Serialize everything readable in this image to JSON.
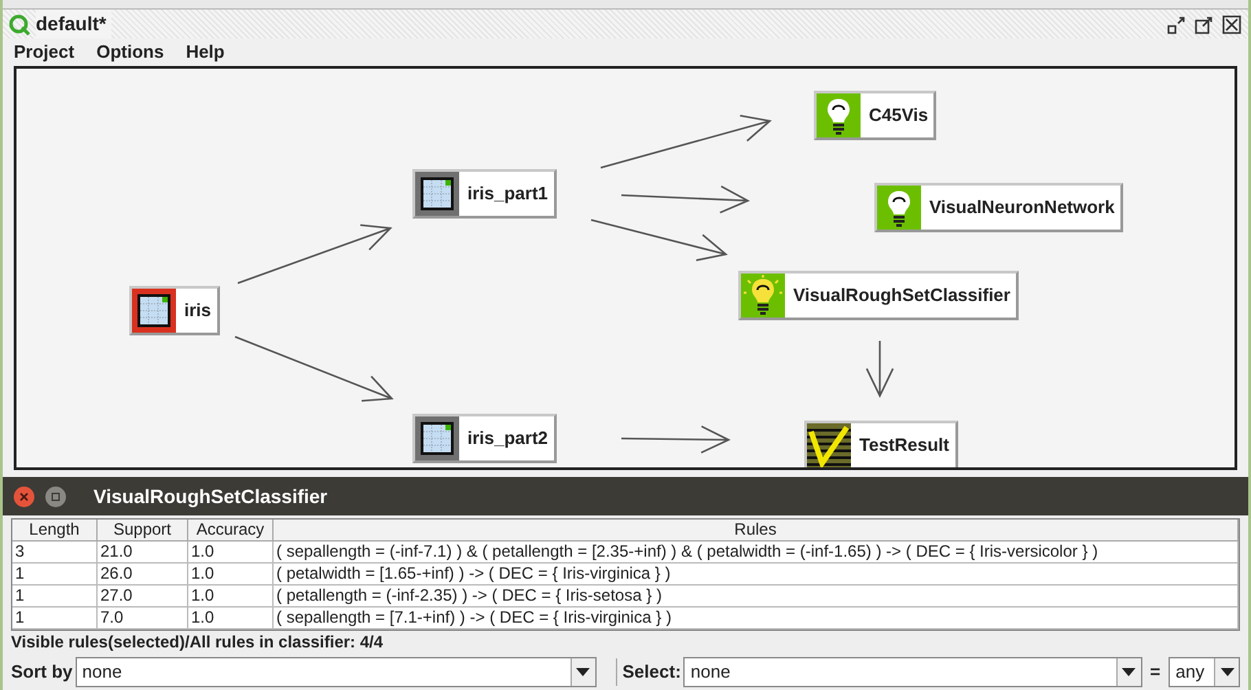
{
  "window": {
    "title": "default*"
  },
  "menu": [
    "Project",
    "Options",
    "Help"
  ],
  "canvas": {
    "nodes": [
      {
        "label": "iris",
        "kind": "table",
        "selected": true
      },
      {
        "label": "iris_part1",
        "kind": "table",
        "selected": false
      },
      {
        "label": "iris_part2",
        "kind": "table",
        "selected": false
      },
      {
        "label": "C45Vis",
        "kind": "visualizer",
        "selected": false,
        "lit": false
      },
      {
        "label": "VisualNeuronNetwork",
        "kind": "visualizer",
        "selected": false,
        "lit": false
      },
      {
        "label": "VisualRoughSetClassifier",
        "kind": "visualizer",
        "selected": false,
        "lit": true
      },
      {
        "label": "TestResult",
        "kind": "result",
        "selected": false
      }
    ]
  },
  "classifier_panel": {
    "title": "VisualRoughSetClassifier",
    "table": {
      "columns": [
        "Length",
        "Support",
        "Accuracy",
        "Rules"
      ],
      "rows": [
        [
          "3",
          "21.0",
          "1.0",
          "( sepallength = (-inf-7.1) ) & ( petallength = [2.35-+inf) ) & ( petalwidth = (-inf-1.65) ) -> ( DEC = { Iris-versicolor } )"
        ],
        [
          "1",
          "26.0",
          "1.0",
          "( petalwidth = [1.65-+inf) ) -> ( DEC = { Iris-virginica } )"
        ],
        [
          "1",
          "27.0",
          "1.0",
          "( petallength = (-inf-2.35) ) -> ( DEC = { Iris-setosa } )"
        ],
        [
          "1",
          "7.0",
          "1.0",
          "( sepallength = [7.1-+inf) ) -> ( DEC = { Iris-virginica } )"
        ]
      ]
    },
    "status": "Visible rules(selected)/All rules in classifier: 4/4",
    "sort": {
      "label": "Sort by",
      "value": "none"
    },
    "select": {
      "label": "Select:",
      "value": "none",
      "operator": "=",
      "operand": "any"
    }
  }
}
